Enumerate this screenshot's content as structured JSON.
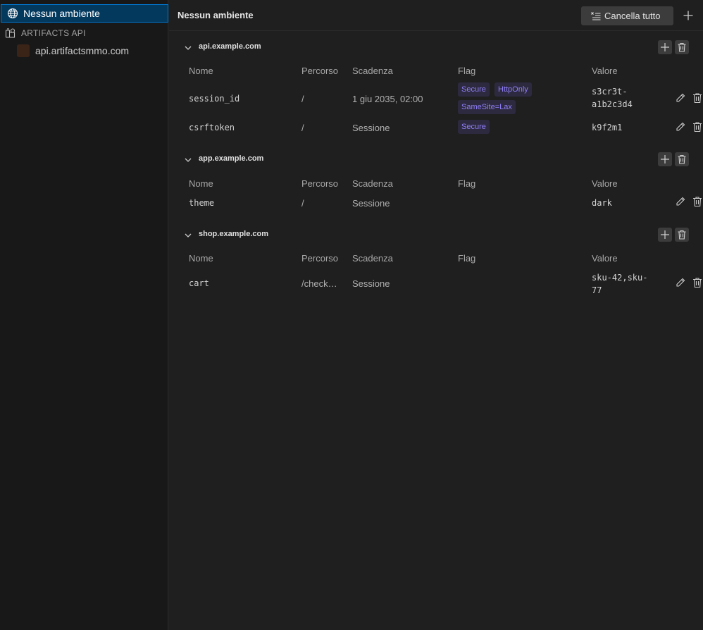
{
  "sidebar": {
    "active": {
      "label": "Nessun ambiente",
      "icon": "globe-icon"
    },
    "group": {
      "label": "ARTIFACTS API",
      "icon": "collection-icon"
    },
    "item": {
      "label": "api.artifactsmmo.com",
      "icon": "favicon"
    }
  },
  "header": {
    "title": "Nessun ambiente",
    "clear_label": "Cancella tutto",
    "clear_icon": "clear-all-icon",
    "add_icon": "plus-icon"
  },
  "columns": {
    "name": "Nome",
    "path": "Percorso",
    "expires": "Scadenza",
    "flags": "Flag",
    "value": "Valore"
  },
  "sections": [
    {
      "domain": "api.example.com",
      "rows": [
        {
          "name": "session_id",
          "path": "/",
          "expires": "1 giu 2035, 02:00",
          "flags": [
            "Secure",
            "HttpOnly",
            "SameSite=Lax"
          ],
          "value": "s3cr3t-a1b2c3d4"
        },
        {
          "name": "csrftoken",
          "path": "/",
          "expires": "Sessione",
          "flags": [
            "Secure"
          ],
          "value": "k9f2m1"
        }
      ]
    },
    {
      "domain": "app.example.com",
      "rows": [
        {
          "name": "theme",
          "path": "/",
          "expires": "Sessione",
          "flags": [],
          "value": "dark"
        }
      ]
    },
    {
      "domain": "shop.example.com",
      "rows": [
        {
          "name": "cart",
          "path": "/check…",
          "expires": "Sessione",
          "flags": [],
          "value": "sku-42,sku-77"
        }
      ]
    }
  ],
  "colors": {
    "accent": "#0078d4",
    "active_bg": "#04395e",
    "tag_text": "#8f7ef5",
    "tag_bg": "#2d2a40"
  }
}
